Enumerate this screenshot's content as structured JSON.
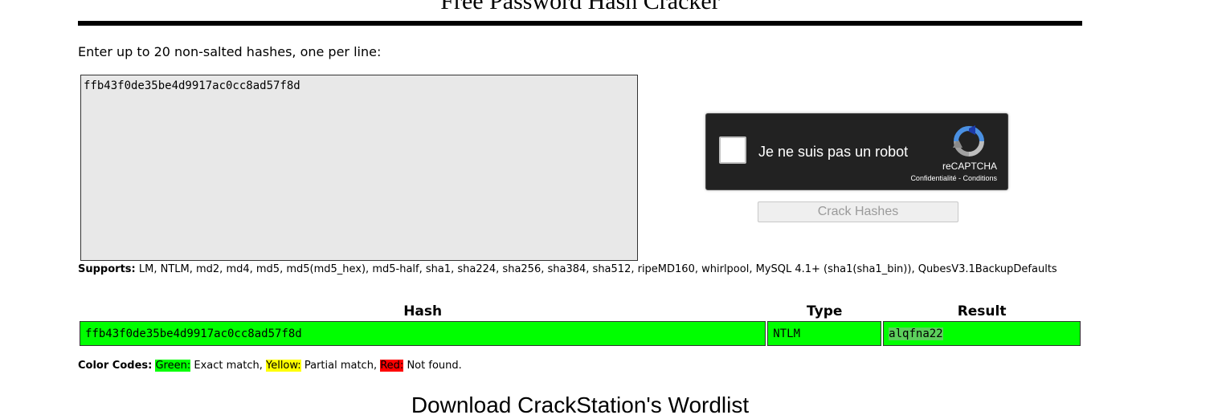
{
  "header": {
    "title": "Free Password Hash Cracker"
  },
  "form": {
    "prompt": "Enter up to 20 non-salted hashes, one per line:",
    "hashes_value": "ffb43f0de35be4d9917ac0cc8ad57f8d",
    "crack_button": "Crack Hashes"
  },
  "captcha": {
    "label": "Je ne suis pas un robot",
    "brand": "reCAPTCHA",
    "links": "Confidentialité - Conditions",
    "icon": "recaptcha-logo-icon"
  },
  "supports": {
    "label": "Supports:",
    "list": "LM, NTLM, md2, md4, md5, md5(md5_hex), md5-half, sha1, sha224, sha256, sha384, sha512, ripeMD160, whirlpool, MySQL 4.1+ (sha1(sha1_bin)), QubesV3.1BackupDefaults"
  },
  "results": {
    "columns": [
      "Hash",
      "Type",
      "Result"
    ],
    "rows": [
      {
        "hash": "ffb43f0de35be4d9917ac0cc8ad57f8d",
        "type": "NTLM",
        "result": "alqfna22"
      }
    ]
  },
  "legend": {
    "label": "Color Codes:",
    "green": "Green:",
    "green_desc": "Exact match,",
    "yellow": "Yellow:",
    "yellow_desc": "Partial match,",
    "red": "Red:",
    "red_desc": "Not found.",
    "colors": {
      "green": "#00ff00",
      "yellow": "#ffff00",
      "red": "#ff0000"
    }
  },
  "footer": {
    "heading": "Download CrackStation's Wordlist"
  }
}
